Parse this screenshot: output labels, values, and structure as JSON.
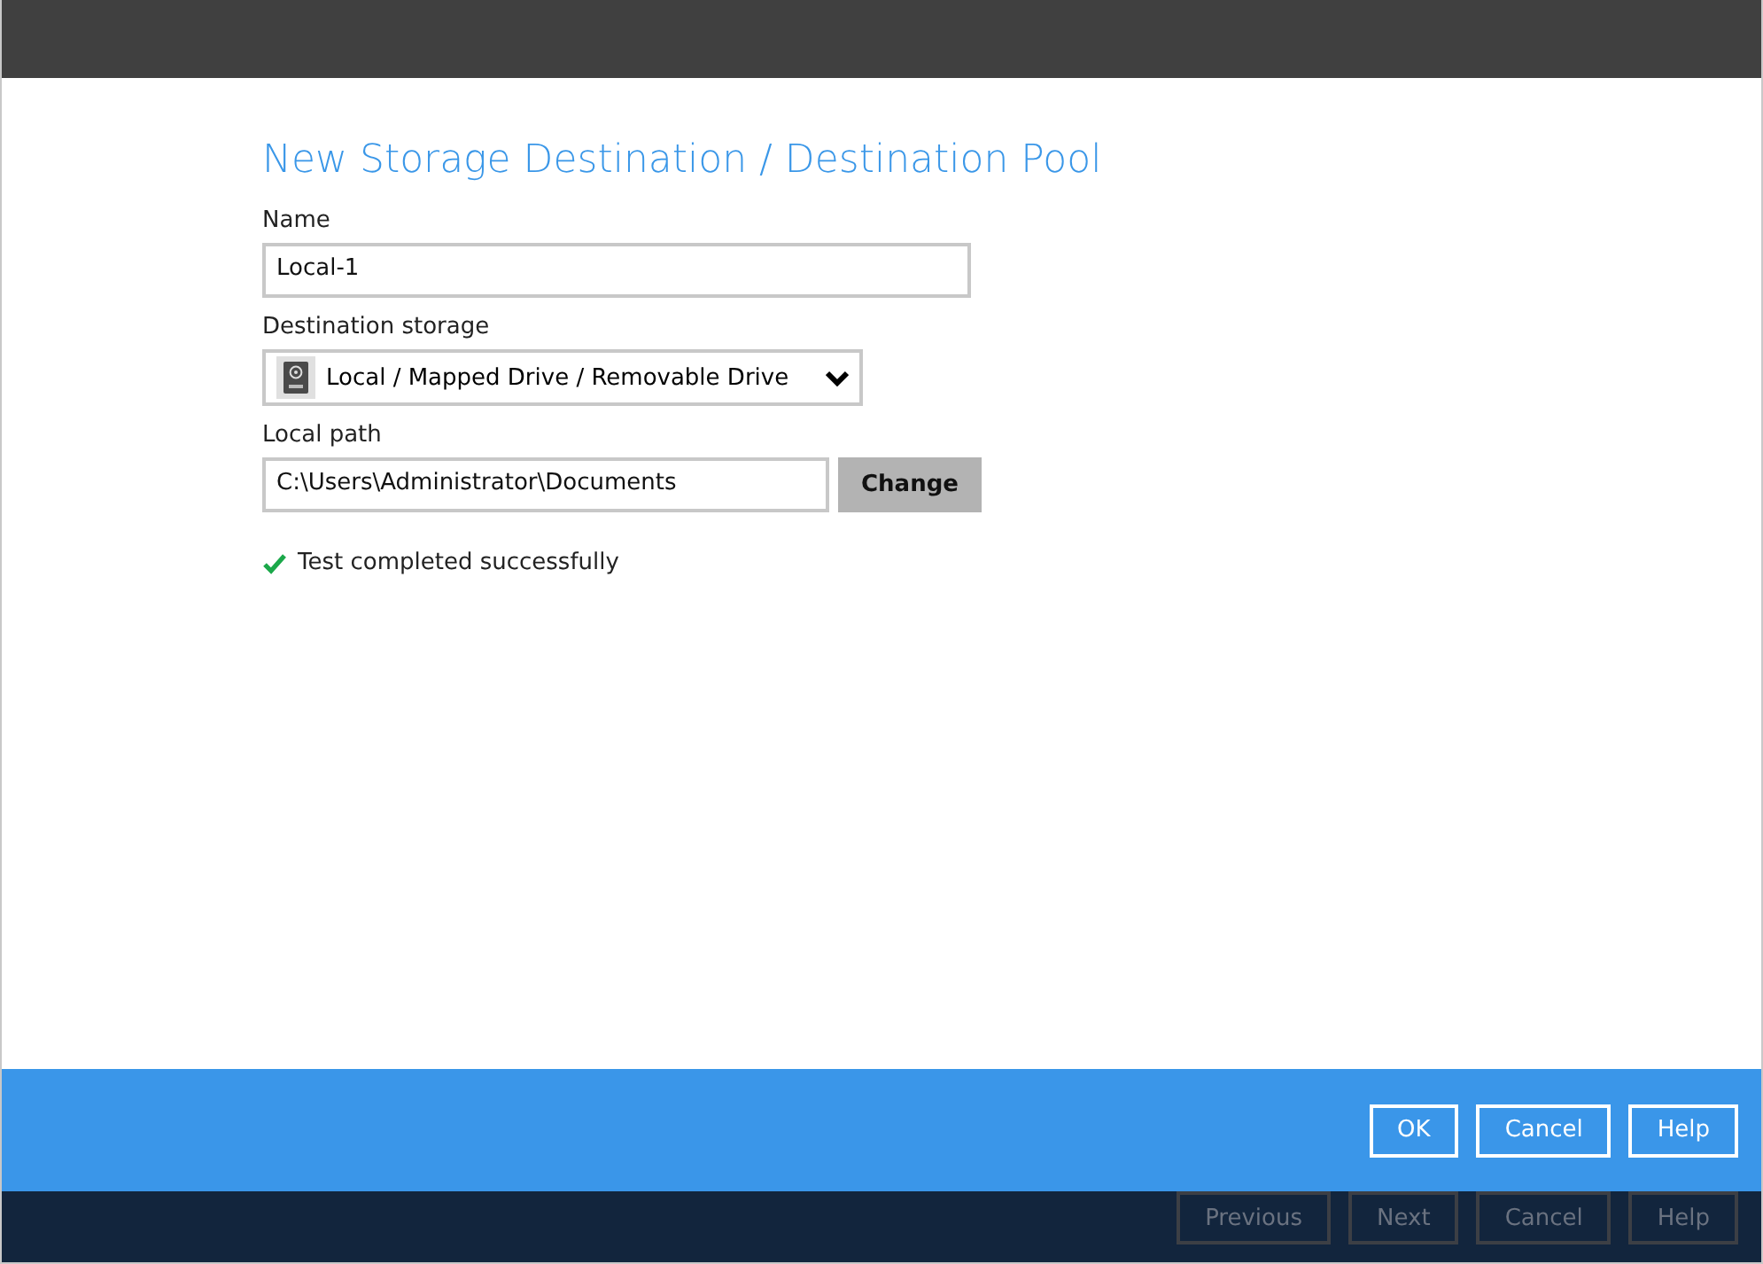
{
  "dialog": {
    "title": "New Storage Destination / Destination Pool",
    "fields": [
      {
        "kind": "text",
        "label": "Name",
        "value": "Local-1"
      },
      {
        "kind": "select",
        "label": "Destination storage",
        "value": "Local / Mapped Drive / Removable Drive"
      },
      {
        "kind": "path",
        "label": "Local path",
        "value": "C:\\Users\\Administrator\\Documents",
        "button": "Change"
      }
    ],
    "status": {
      "ok": true,
      "text": "Test completed successfully"
    },
    "buttons": [
      "OK",
      "Cancel",
      "Help"
    ]
  },
  "wizard_buttons": [
    {
      "label": "Previous",
      "disabled": true
    },
    {
      "label": "Next",
      "disabled": true
    },
    {
      "label": "Cancel",
      "disabled": true
    },
    {
      "label": "Help",
      "disabled": true
    }
  ]
}
